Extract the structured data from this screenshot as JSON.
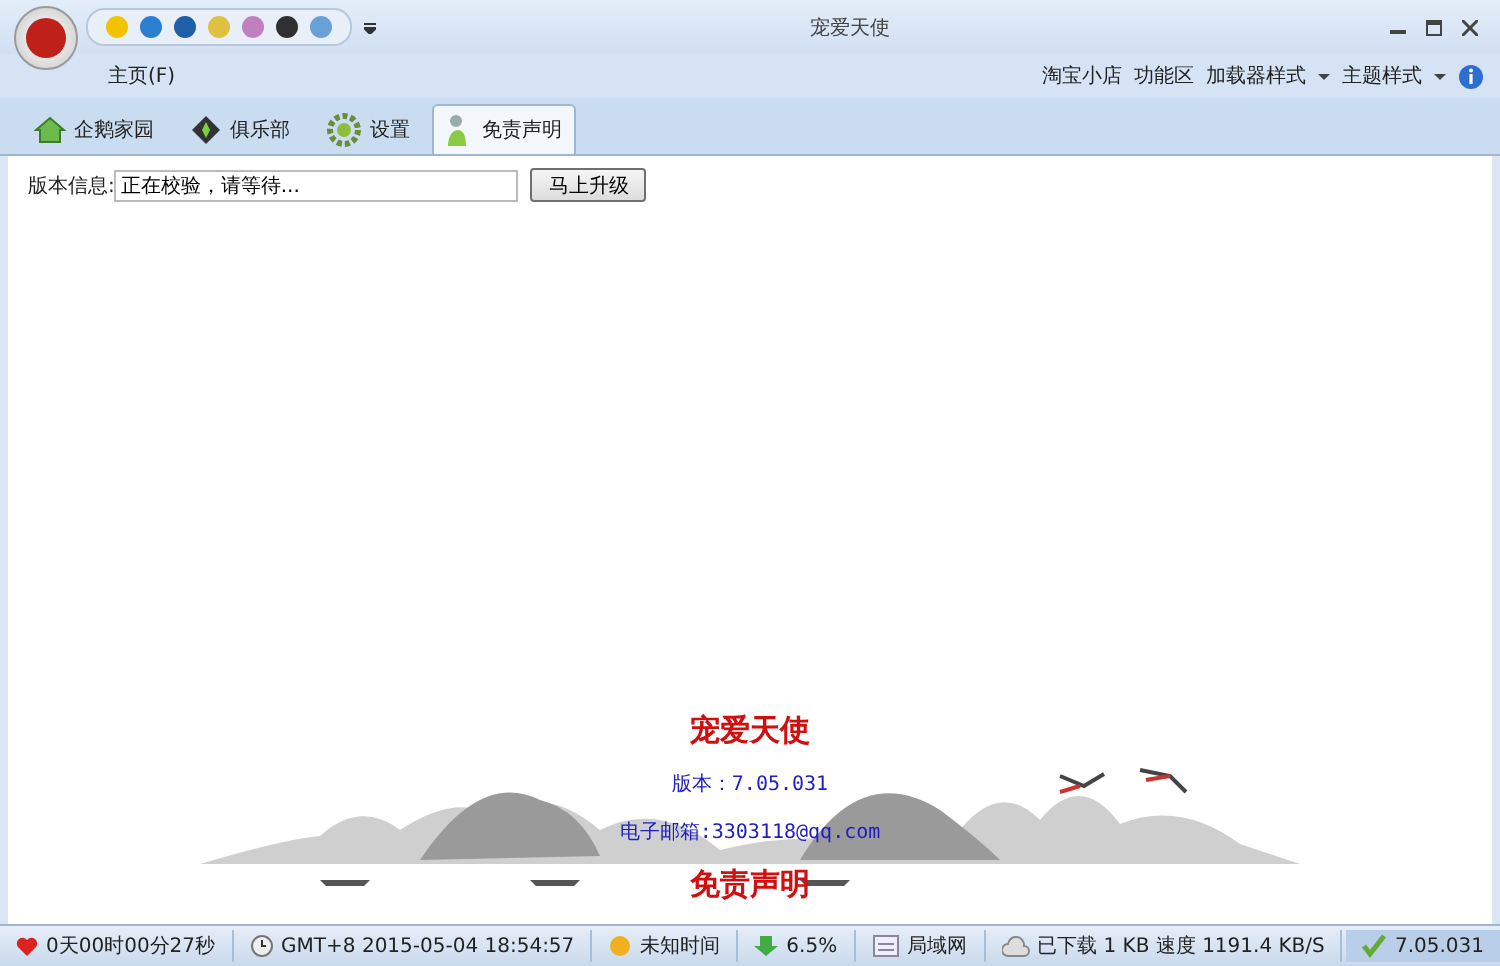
{
  "window": {
    "title": "宠爱天使"
  },
  "menu": {
    "home": "主页(F)",
    "links": [
      {
        "label": "淘宝小店",
        "kind": "link"
      },
      {
        "label": "功能区",
        "kind": "link"
      },
      {
        "label": "加载器样式",
        "kind": "dropdown"
      },
      {
        "label": "主题样式",
        "kind": "dropdown"
      }
    ]
  },
  "tabs": [
    {
      "label": "企鹅家园",
      "selected": false
    },
    {
      "label": "俱乐部",
      "selected": false
    },
    {
      "label": "设置",
      "selected": false
    },
    {
      "label": "免责声明",
      "selected": true
    }
  ],
  "version_row": {
    "label": "版本信息:",
    "value": "正在校验，请等待...",
    "button": "马上升级"
  },
  "about": {
    "title": "宠爱天使",
    "version": "版本：7.05.031",
    "email": "电子邮箱:3303118@qq.com",
    "disclaimer": "免责声明"
  },
  "status_bar": [
    {
      "text": "0天00时00分27秒",
      "kind": "uptime"
    },
    {
      "text": "GMT+8 2015-05-04 18:54:57",
      "kind": "clock"
    },
    {
      "text": "未知时间",
      "kind": "coin"
    },
    {
      "text": "6.5%",
      "kind": "cpu"
    },
    {
      "text": "局域网",
      "kind": "network"
    },
    {
      "text": "已下载 1 KB 速度 1191.4 KB/S",
      "kind": "download"
    },
    {
      "text": "7.05.031",
      "kind": "version"
    }
  ]
}
